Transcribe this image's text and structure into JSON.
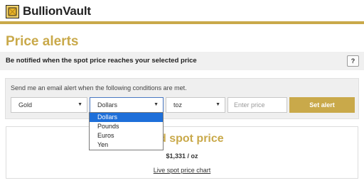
{
  "brand": {
    "name": "BullionVault",
    "icon": "bullionvault-logo-icon",
    "accent": "#c9a94a"
  },
  "page": {
    "title": "Price alerts"
  },
  "subheader": {
    "text": "Be notified when the spot price reaches your selected price",
    "help_label": "?"
  },
  "alert_form": {
    "description": "Send me an email alert when the following conditions are met.",
    "metal": {
      "value": "Gold"
    },
    "currency": {
      "value": "Dollars",
      "options": [
        "Dollars",
        "Pounds",
        "Euros",
        "Yen"
      ],
      "highlighted": "Dollars"
    },
    "unit": {
      "value": "toz"
    },
    "price": {
      "value": "",
      "placeholder": "Enter price"
    },
    "submit_label": "Set alert"
  },
  "spot_card": {
    "title": "Gold spot price",
    "price": "$1,331 / oz",
    "link_label": "Live spot price chart"
  }
}
